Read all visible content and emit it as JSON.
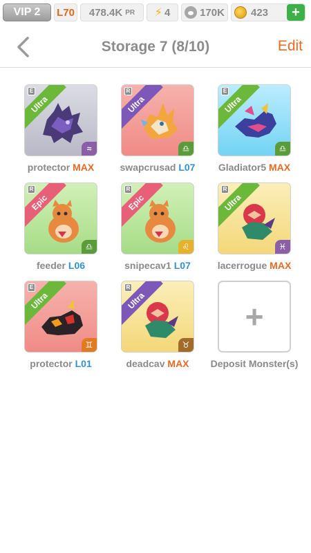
{
  "statusbar": {
    "vip": "VIP 2",
    "level": "L70",
    "power": "478.4K",
    "power_unit": "PR",
    "energy": "4",
    "food": "170K",
    "gold": "423",
    "add": "+"
  },
  "header": {
    "title": "Storage 7 (8/10)",
    "edit": "Edit"
  },
  "monsters": [
    {
      "name": "protector",
      "level": "MAX",
      "rarity": "Ultra",
      "tag": "E",
      "sign": "≈"
    },
    {
      "name": "swapcrusad",
      "level": "L07",
      "rarity": "Ultra",
      "tag": "R",
      "sign": "♎"
    },
    {
      "name": "Gladiator5",
      "level": "MAX",
      "rarity": "Ultra",
      "tag": "E",
      "sign": "♎"
    },
    {
      "name": "feeder",
      "level": "L06",
      "rarity": "Epic",
      "tag": "R",
      "sign": "♎"
    },
    {
      "name": "snipecav1",
      "level": "L07",
      "rarity": "Epic",
      "tag": "R",
      "sign": "♌"
    },
    {
      "name": "lacerrogue",
      "level": "MAX",
      "rarity": "Ultra",
      "tag": "R",
      "sign": "♓"
    },
    {
      "name": "protector",
      "level": "L01",
      "rarity": "Ultra",
      "tag": "E",
      "sign": "♊"
    },
    {
      "name": "deadcav",
      "level": "MAX",
      "rarity": "Ultra",
      "tag": "R",
      "sign": "♉"
    }
  ],
  "deposit": {
    "plus": "+",
    "label": "Deposit Monster(s)"
  },
  "colors": {
    "accent": "#e46d22",
    "level_blue": "#3390d2",
    "text_gray": "#8a8a8a"
  }
}
